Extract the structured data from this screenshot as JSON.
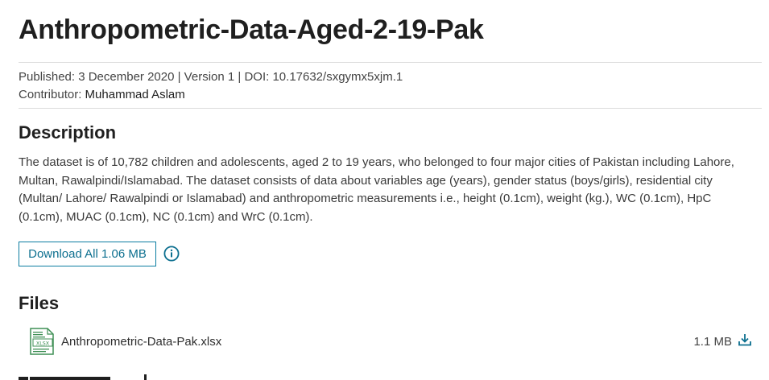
{
  "dataset": {
    "title": "Anthropometric-Data-Aged-2-19-Pak",
    "meta_line": "Published: 3 December 2020 | Version 1 | DOI: 10.17632/sxgymx5xjm.1",
    "contributor_label": "Contributor:",
    "contributor_name": "Muhammad Aslam"
  },
  "description": {
    "heading": "Description",
    "text": "The dataset is of 10,782 children and adolescents, aged 2 to 19 years, who belonged to four major cities of Pakistan including Lahore, Multan, Rawalpindi/Islamabad. The dataset consists of data about variables age (years), gender status (boys/girls), residential city (Multan/ Lahore/ Rawalpindi or Islamabad) and anthropometric measurements i.e., height (0.1cm), weight (kg.), WC (0.1cm), HpC (0.1cm), MUAC (0.1cm), NC (0.1cm) and WrC (0.1cm)."
  },
  "download": {
    "button_label": "Download All 1.06 MB",
    "info_icon": "info-icon"
  },
  "files": {
    "heading": "Files",
    "items": [
      {
        "icon": "xlsx-file-icon",
        "icon_text": "XLSX",
        "name": "Anthropometric-Data-Pak.xlsx",
        "size": "1.1 MB",
        "action_icon": "download-icon"
      }
    ]
  },
  "colors": {
    "accent": "#0c7da1",
    "xlsx_green": "#3f8f55"
  }
}
